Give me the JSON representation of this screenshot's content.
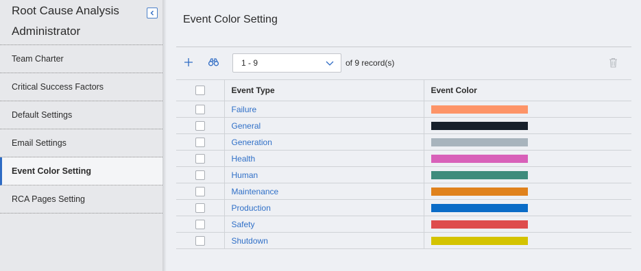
{
  "sidebar": {
    "title": "Root Cause Analysis Administrator",
    "items": [
      {
        "label": "Team Charter",
        "active": false
      },
      {
        "label": "Critical Success Factors",
        "active": false
      },
      {
        "label": "Default Settings",
        "active": false
      },
      {
        "label": "Email Settings",
        "active": false
      },
      {
        "label": "Event Color Setting",
        "active": true
      },
      {
        "label": "RCA Pages Setting",
        "active": false
      }
    ]
  },
  "main": {
    "title": "Event Color Setting",
    "toolbar": {
      "page_range": "1 - 9",
      "records_text": "of 9  record(s)",
      "icons": [
        "plus-icon",
        "binoculars-icon",
        "chevron-down-icon",
        "trash-icon"
      ]
    },
    "table": {
      "columns": [
        "Event Type",
        "Event Color"
      ],
      "rows": [
        {
          "type": "Failure",
          "color": "#fd9468"
        },
        {
          "type": "General",
          "color": "#17202b"
        },
        {
          "type": "Generation",
          "color": "#a8b4bd"
        },
        {
          "type": "Health",
          "color": "#d861b9"
        },
        {
          "type": "Human",
          "color": "#3e8c7c"
        },
        {
          "type": "Maintenance",
          "color": "#e0821d"
        },
        {
          "type": "Production",
          "color": "#0a6cc7"
        },
        {
          "type": "Safety",
          "color": "#de4c4c"
        },
        {
          "type": "Shutdown",
          "color": "#d4c300"
        }
      ]
    }
  },
  "colors": {
    "accent": "#2e6bc4",
    "link": "#2f6fc7"
  }
}
